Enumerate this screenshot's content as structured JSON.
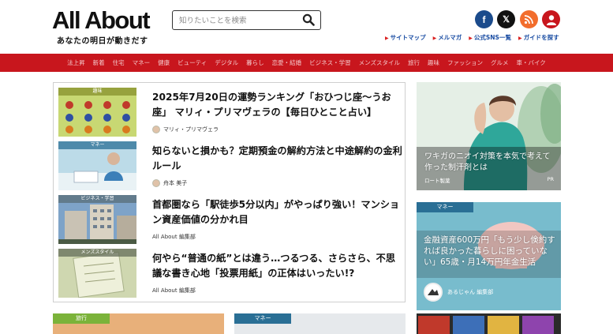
{
  "header": {
    "logo": "All About",
    "tagline": "あなたの明日が動きだす",
    "search": {
      "placeholder": "知りたいことを検索"
    },
    "social": [
      {
        "name": "facebook-icon",
        "glyph": "f",
        "color": "#1b4b8c"
      },
      {
        "name": "x-icon",
        "glyph": "𝕏",
        "color": "#111111"
      },
      {
        "name": "rss-icon",
        "glyph": "",
        "color": "#f26d2c"
      },
      {
        "name": "user-icon",
        "glyph": "",
        "color": "#c8161d"
      }
    ],
    "util_links": [
      "サイトマップ",
      "メルマガ",
      "公式SNS一覧",
      "ガイドを探す"
    ]
  },
  "nav": [
    "法上昇",
    "新着",
    "住宅",
    "マネー",
    "健康",
    "ビューティ",
    "デジタル",
    "暮らし",
    "恋愛・結婚",
    "ビジネス・学習",
    "メンズスタイル",
    "旅行",
    "趣味",
    "ファッション",
    "グルメ",
    "車・バイク"
  ],
  "feature": {
    "articles": [
      {
        "tag": "趣味",
        "title": "2025年7月20日の運勢ランキング「おひつじ座～うお座」 マリィ・プリマヴェラの【毎日ひとこと占い】",
        "author": "マリィ・プリマヴェラ"
      },
      {
        "tag": "マネー",
        "title": "知らないと損かも？定期預金の解約方法と中途解約の金利ルール",
        "author": "舟本 美子"
      },
      {
        "tag": "ビジネス・学習",
        "title": "首都圏なら「駅徒歩5分以内」がやっぱり強い！マンション資産価値の分かれ目",
        "author": "All About 編集部"
      },
      {
        "tag": "メンズスタイル",
        "title": "何やら“普通の紙”とは違う…つるつる、さらさら、不思議な書き心地「投票用紙」の正体はいったい!?",
        "author": "All About 編集部"
      }
    ]
  },
  "promo": {
    "title": "ワキガのニオイ対策を本気で考えて作った制汗剤とは",
    "sponsor": "ロート製薬",
    "pr": "PR"
  },
  "money_card": {
    "tag": "マネー",
    "title": "金融資産600万円「もう少し倹約すれば良かった暮らしに困っていない」65歳・月14万円年金生活",
    "author": "あるじゃん 編集部"
  },
  "bottom": [
    {
      "tag": "旅行",
      "color": "#7bb33a"
    },
    {
      "tag": "マネー",
      "color": "#2a6f95"
    }
  ]
}
